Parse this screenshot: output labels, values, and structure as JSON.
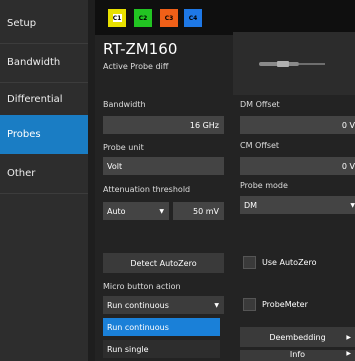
{
  "sidebar": {
    "items": [
      {
        "label": "Setup",
        "active": false
      },
      {
        "label": "Bandwidth",
        "active": false
      },
      {
        "label": "Differential",
        "active": false
      },
      {
        "label": "Probes",
        "active": true
      },
      {
        "label": "Other",
        "active": false
      }
    ]
  },
  "channels": [
    {
      "label": "C1",
      "color": "#e8e000"
    },
    {
      "label": "C2",
      "color": "#22c422"
    },
    {
      "label": "C3",
      "color": "#f06018"
    },
    {
      "label": "C4",
      "color": "#1e78e6"
    }
  ],
  "probe": {
    "name": "RT-ZM160",
    "subtitle": "Active Probe diff",
    "close_symbol": "×"
  },
  "bandwidth": {
    "label": "Bandwidth",
    "value": "16 GHz"
  },
  "probe_unit": {
    "label": "Probe unit",
    "value": "Volt"
  },
  "attenuation": {
    "label": "Attenuation threshold",
    "mode": "Auto",
    "value": "50 mV"
  },
  "dm_offset": {
    "label": "DM Offset",
    "value": "0 V"
  },
  "cm_offset": {
    "label": "CM Offset",
    "value": "0 V"
  },
  "probe_mode": {
    "label": "Probe mode",
    "value": "DM"
  },
  "detect_button": "Detect AutoZero",
  "use_autozero": "Use AutoZero",
  "micro_button": {
    "label": "Micro button action",
    "selected": "Run continuous",
    "options": [
      "Run continuous",
      "Run single"
    ]
  },
  "probemeter": "ProbeMeter",
  "deembedding": "Deembedding",
  "info": "Info"
}
